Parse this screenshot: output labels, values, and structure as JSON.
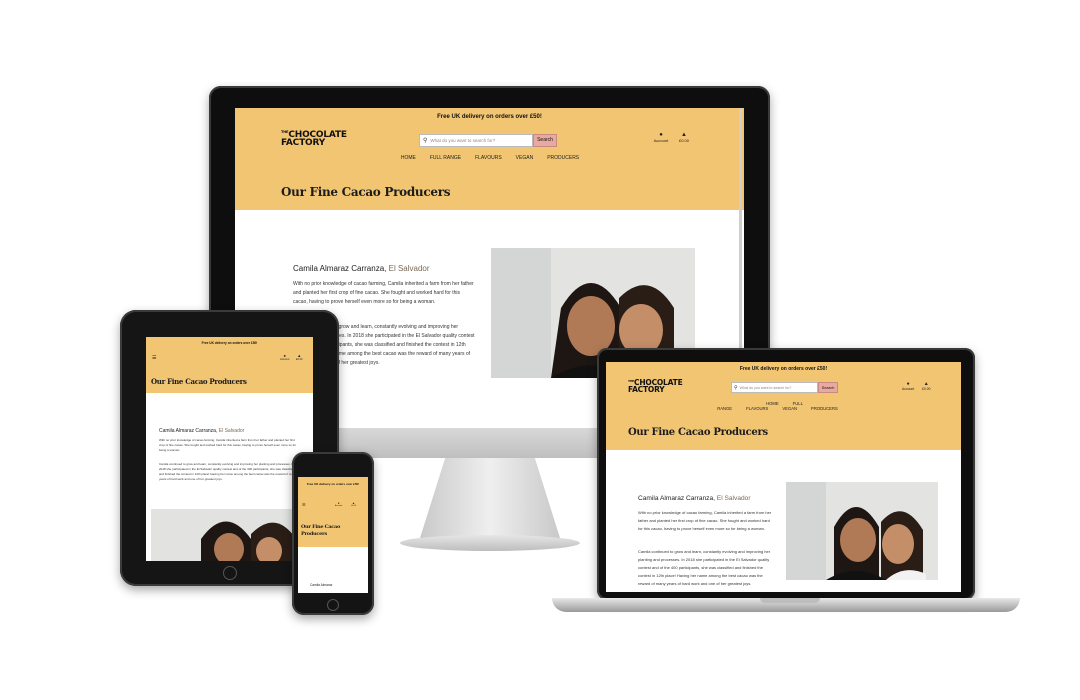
{
  "banner": "Free UK delivery on orders over £50!",
  "brand": {
    "the": "THE",
    "line1": "CHOCOLATE",
    "line2": "FACTORY"
  },
  "search": {
    "placeholder": "What do you want to search for?",
    "button": "Search"
  },
  "account": {
    "label": "Account",
    "bag": "£0.00"
  },
  "nav": [
    "HOME",
    "FULL RANGE",
    "FLAVOURS",
    "VEGAN",
    "PRODUCERS"
  ],
  "page_title": "Our Fine Cacao Producers",
  "producer": {
    "name": "Camila Almaraz Carranza,",
    "location": "El Salvador",
    "p1": "With no prior knowledge of cacao farming, Camila inherited a farm from her father and planted her first crop of fine cacao. She fought and worked hard for this cacao, having to prove herself even more so for being a woman.",
    "p2": "Camila continued to grow and learn, constantly evolving and improving her planting and processes. In 2018 she participated in the El Salvador quality contest and of the 400 participants, she was classified and finished the contest in 12th place! Having her name among the best cacao was the reward of many years of hard work and one of her greatest joys."
  },
  "mobile_name": "Camila Almaraz",
  "colors": {
    "banner": "#f2c572",
    "search_button": "#e8a9a0",
    "location": "#7a6a55"
  }
}
